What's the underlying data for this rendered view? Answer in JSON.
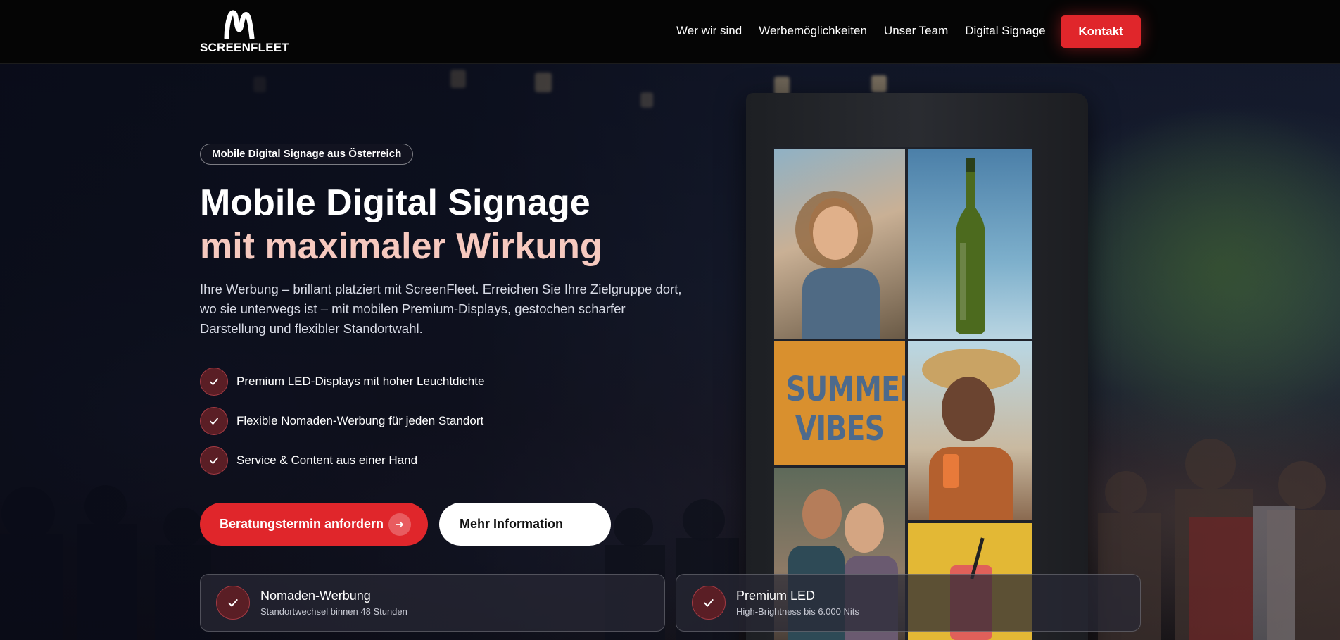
{
  "brand": {
    "name": "SCREENFLEET",
    "logo_icon": "m-mark-logo"
  },
  "nav": {
    "links": [
      "Wer wir sind",
      "Werbemöglichkeiten",
      "Unser Team",
      "Digital Signage"
    ],
    "cta": "Kontakt"
  },
  "hero": {
    "badge": "Mobile Digital Signage aus Österreich",
    "headline_line1": "Mobile Digital Signage",
    "headline_line2": "mit maximaler Wirkung",
    "lead": "Ihre Werbung – brillant platziert mit ScreenFleet. Erreichen Sie Ihre Zielgruppe dort, wo sie unterwegs ist – mit mobilen Premium-Displays, gestochen scharfer Darstellung und flexibler Standortwahl.",
    "features": [
      "Premium LED-Displays mit hoher Leuchtdichte",
      "Flexible Nomaden-Werbung für jeden Standort",
      "Service & Content aus einer Hand"
    ],
    "primary_button": "Beratungstermin anfordern",
    "secondary_button": "Mehr Information"
  },
  "display_screen": {
    "tile_text": "SUMMER VIBES"
  },
  "cards": [
    {
      "title": "Nomaden-Werbung",
      "subtitle": "Standortwechsel binnen 48 Stunden"
    },
    {
      "title": "Premium LED",
      "subtitle": "High-Brightness bis 6.000 Nits"
    }
  ],
  "colors": {
    "accent": "#e0262b",
    "headline_highlight": "#f6c9bf",
    "nav_background": "#050505",
    "check_circle": "#5a1e25"
  }
}
